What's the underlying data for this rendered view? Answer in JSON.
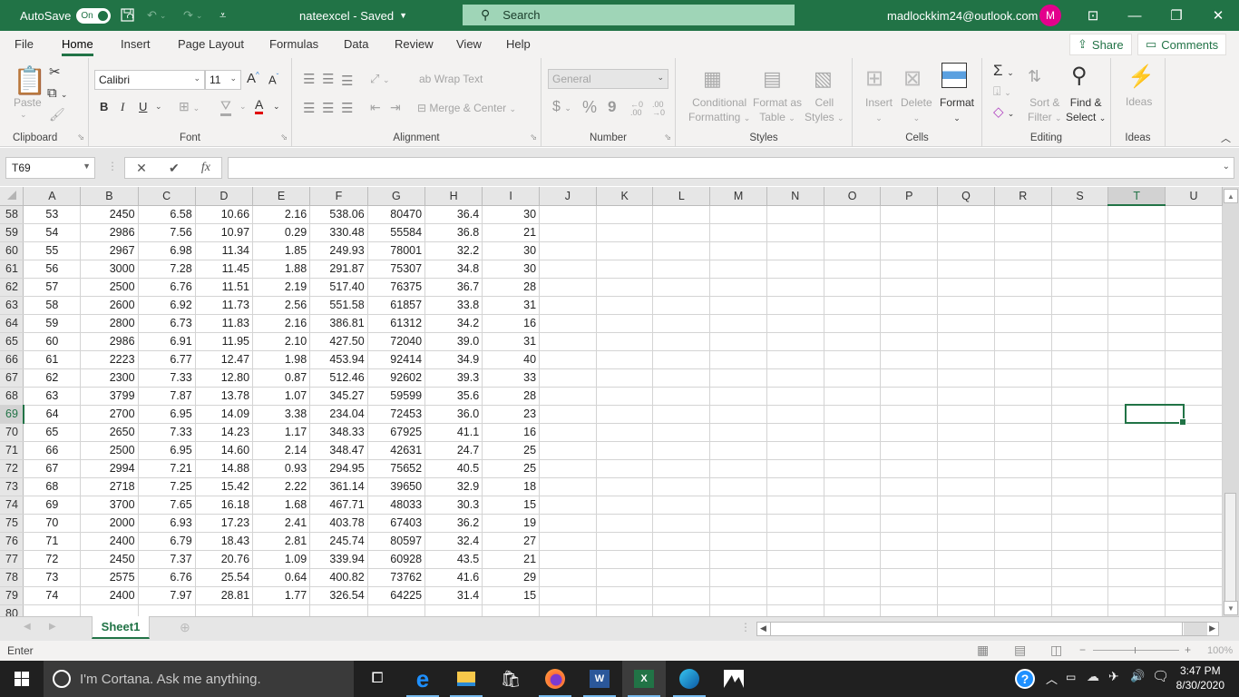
{
  "titlebar": {
    "autosave_label": "AutoSave",
    "autosave_state": "On",
    "doc_title": "nateexcel  -  Saved",
    "search_placeholder": "Search",
    "account_email": "madlockkim24@outlook.com",
    "avatar_initial": "M",
    "accent_color": "#217346"
  },
  "menu": {
    "tabs": [
      "File",
      "Home",
      "Insert",
      "Page Layout",
      "Formulas",
      "Data",
      "Review",
      "View",
      "Help"
    ],
    "active": "Home",
    "share_label": "Share",
    "comments_label": "Comments"
  },
  "ribbon": {
    "clipboard": {
      "paste": "Paste",
      "label": "Clipboard"
    },
    "font": {
      "name": "Calibri",
      "size": "11",
      "bold": "B",
      "italic": "I",
      "underline": "U",
      "label": "Font",
      "font_color": "#e00000"
    },
    "alignment": {
      "wrap_text": "Wrap Text",
      "merge_center": "Merge & Center",
      "label": "Alignment"
    },
    "number": {
      "format": "General",
      "currency": "$",
      "percent": "%",
      "comma": "9",
      "label": "Number"
    },
    "styles": {
      "conditional_1": "Conditional",
      "conditional_2": "Formatting",
      "format_table_1": "Format as",
      "format_table_2": "Table",
      "cell_styles_1": "Cell",
      "cell_styles_2": "Styles",
      "label": "Styles"
    },
    "cells": {
      "insert": "Insert",
      "delete": "Delete",
      "format": "Format",
      "label": "Cells"
    },
    "editing": {
      "sort_1": "Sort &",
      "sort_2": "Filter",
      "find_1": "Find &",
      "find_2": "Select",
      "label": "Editing"
    },
    "ideas": {
      "button": "Ideas",
      "label": "Ideas"
    }
  },
  "formula_bar": {
    "name_box": "T69",
    "formula": ""
  },
  "sheet": {
    "columns": [
      "A",
      "B",
      "C",
      "D",
      "E",
      "F",
      "G",
      "H",
      "I",
      "J",
      "K",
      "L",
      "M",
      "N",
      "O",
      "P",
      "Q",
      "R",
      "S",
      "T",
      "U"
    ],
    "selected_column": "T",
    "selected_row": 69,
    "rows": [
      {
        "n": 58,
        "cells": [
          "53",
          "2450",
          "6.58",
          "10.66",
          "2.16",
          "538.06",
          "80470",
          "36.4",
          "30"
        ]
      },
      {
        "n": 59,
        "cells": [
          "54",
          "2986",
          "7.56",
          "10.97",
          "0.29",
          "330.48",
          "55584",
          "36.8",
          "21"
        ]
      },
      {
        "n": 60,
        "cells": [
          "55",
          "2967",
          "6.98",
          "11.34",
          "1.85",
          "249.93",
          "78001",
          "32.2",
          "30"
        ]
      },
      {
        "n": 61,
        "cells": [
          "56",
          "3000",
          "7.28",
          "11.45",
          "1.88",
          "291.87",
          "75307",
          "34.8",
          "30"
        ]
      },
      {
        "n": 62,
        "cells": [
          "57",
          "2500",
          "6.76",
          "11.51",
          "2.19",
          "517.40",
          "76375",
          "36.7",
          "28"
        ]
      },
      {
        "n": 63,
        "cells": [
          "58",
          "2600",
          "6.92",
          "11.73",
          "2.56",
          "551.58",
          "61857",
          "33.8",
          "31"
        ]
      },
      {
        "n": 64,
        "cells": [
          "59",
          "2800",
          "6.73",
          "11.83",
          "2.16",
          "386.81",
          "61312",
          "34.2",
          "16"
        ]
      },
      {
        "n": 65,
        "cells": [
          "60",
          "2986",
          "6.91",
          "11.95",
          "2.10",
          "427.50",
          "72040",
          "39.0",
          "31"
        ]
      },
      {
        "n": 66,
        "cells": [
          "61",
          "2223",
          "6.77",
          "12.47",
          "1.98",
          "453.94",
          "92414",
          "34.9",
          "40"
        ]
      },
      {
        "n": 67,
        "cells": [
          "62",
          "2300",
          "7.33",
          "12.80",
          "0.87",
          "512.46",
          "92602",
          "39.3",
          "33"
        ]
      },
      {
        "n": 68,
        "cells": [
          "63",
          "3799",
          "7.87",
          "13.78",
          "1.07",
          "345.27",
          "59599",
          "35.6",
          "28"
        ]
      },
      {
        "n": 69,
        "cells": [
          "64",
          "2700",
          "6.95",
          "14.09",
          "3.38",
          "234.04",
          "72453",
          "36.0",
          "23"
        ]
      },
      {
        "n": 70,
        "cells": [
          "65",
          "2650",
          "7.33",
          "14.23",
          "1.17",
          "348.33",
          "67925",
          "41.1",
          "16"
        ]
      },
      {
        "n": 71,
        "cells": [
          "66",
          "2500",
          "6.95",
          "14.60",
          "2.14",
          "348.47",
          "42631",
          "24.7",
          "25"
        ]
      },
      {
        "n": 72,
        "cells": [
          "67",
          "2994",
          "7.21",
          "14.88",
          "0.93",
          "294.95",
          "75652",
          "40.5",
          "25"
        ]
      },
      {
        "n": 73,
        "cells": [
          "68",
          "2718",
          "7.25",
          "15.42",
          "2.22",
          "361.14",
          "39650",
          "32.9",
          "18"
        ]
      },
      {
        "n": 74,
        "cells": [
          "69",
          "3700",
          "7.65",
          "16.18",
          "1.68",
          "467.71",
          "48033",
          "30.3",
          "15"
        ]
      },
      {
        "n": 75,
        "cells": [
          "70",
          "2000",
          "6.93",
          "17.23",
          "2.41",
          "403.78",
          "67403",
          "36.2",
          "19"
        ]
      },
      {
        "n": 76,
        "cells": [
          "71",
          "2400",
          "6.79",
          "18.43",
          "2.81",
          "245.74",
          "80597",
          "32.4",
          "27"
        ]
      },
      {
        "n": 77,
        "cells": [
          "72",
          "2450",
          "7.37",
          "20.76",
          "1.09",
          "339.94",
          "60928",
          "43.5",
          "21"
        ]
      },
      {
        "n": 78,
        "cells": [
          "73",
          "2575",
          "6.76",
          "25.54",
          "0.64",
          "400.82",
          "73762",
          "41.6",
          "29"
        ]
      },
      {
        "n": 79,
        "cells": [
          "74",
          "2400",
          "7.97",
          "28.81",
          "1.77",
          "326.54",
          "64225",
          "31.4",
          "15"
        ]
      },
      {
        "n": 80,
        "cells": [
          "",
          "",
          "",
          "",
          "",
          "",
          "",
          "",
          ""
        ]
      }
    ]
  },
  "tabs": {
    "sheets": [
      "Sheet1"
    ],
    "active": "Sheet1"
  },
  "status": {
    "mode": "Enter",
    "zoom": "100%"
  },
  "taskbar": {
    "cortana_placeholder": "I'm Cortana. Ask me anything.",
    "time": "3:47 PM",
    "date": "8/30/2020",
    "apps": [
      "task-view",
      "edge-legacy",
      "file-explorer",
      "store",
      "firefox",
      "word",
      "excel",
      "edge",
      "photos"
    ],
    "active_app": "excel"
  }
}
